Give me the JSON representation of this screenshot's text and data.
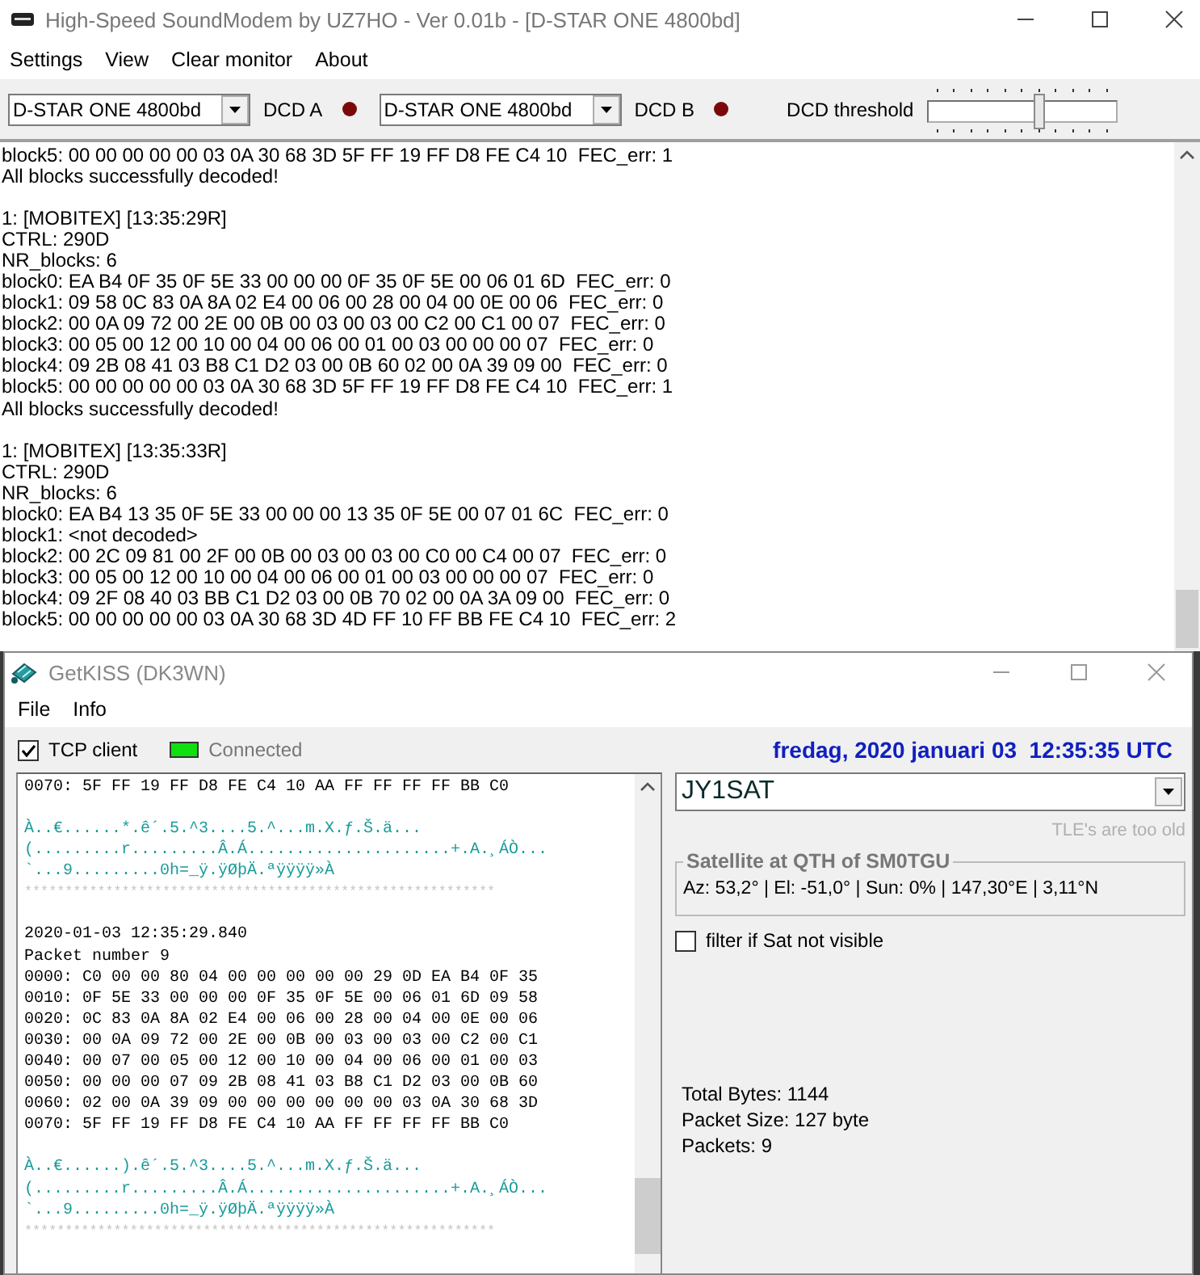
{
  "modem_window": {
    "title": "High-Speed SoundModem by UZ7HO - Ver 0.01b - [D-STAR ONE 4800bd]",
    "menu": [
      "Settings",
      "View",
      "Clear monitor",
      "About"
    ],
    "toolbar": {
      "mode_a": "D-STAR ONE 4800bd",
      "dcd_a_label": "DCD A",
      "dcd_a_active": false,
      "mode_b": "D-STAR ONE 4800bd",
      "dcd_b_label": "DCD B",
      "dcd_b_active": false,
      "threshold_label": "DCD threshold",
      "threshold": {
        "level": 0.59
      }
    },
    "monitor": [
      {
        "lines": [
          "block5: 00 00 00 00 00 03 0A 30 68 3D 5F FF 19 FF D8 FE C4 10  FEC_err: 1",
          "All blocks successfully decoded!"
        ]
      },
      {
        "lines": [
          "1: [MOBITEX] [13:35:29R]",
          "CTRL: 290D",
          "NR_blocks: 6",
          "block0: EA B4 0F 35 0F 5E 33 00 00 00 0F 35 0F 5E 00 06 01 6D  FEC_err: 0",
          "block1: 09 58 0C 83 0A 8A 02 E4 00 06 00 28 00 04 00 0E 00 06  FEC_err: 0",
          "block2: 00 0A 09 72 00 2E 00 0B 00 03 00 03 00 C2 00 C1 00 07  FEC_err: 0",
          "block3: 00 05 00 12 00 10 00 04 00 06 00 01 00 03 00 00 00 07  FEC_err: 0",
          "block4: 09 2B 08 41 03 B8 C1 D2 03 00 0B 60 02 00 0A 39 09 00  FEC_err: 0",
          "block5: 00 00 00 00 00 03 0A 30 68 3D 5F FF 19 FF D8 FE C4 10  FEC_err: 1",
          "All blocks successfully decoded!"
        ]
      },
      {
        "lines": [
          "1: [MOBITEX] [13:35:33R]",
          "CTRL: 290D",
          "NR_blocks: 6",
          "block0: EA B4 13 35 0F 5E 33 00 00 00 13 35 0F 5E 00 07 01 6C  FEC_err: 0",
          "block1: <not decoded>",
          "block2: 00 2C 09 81 00 2F 00 0B 00 03 00 03 00 C0 00 C4 00 07  FEC_err: 0",
          "block3: 00 05 00 12 00 10 00 04 00 06 00 01 00 03 00 00 00 07  FEC_err: 0",
          "block4: 09 2F 08 40 03 BB C1 D2 03 00 0B 70 02 00 0A 3A 09 00  FEC_err: 0",
          "block5: 00 00 00 00 00 03 0A 30 68 3D 4D FF 10 FF BB FE C4 10  FEC_err: 2"
        ]
      }
    ]
  },
  "kiss_window": {
    "title": "GetKISS (DK3WN)",
    "menu": [
      "File",
      "Info"
    ],
    "tcp_client": {
      "label": "TCP client",
      "checked": true
    },
    "connection": {
      "label": "Connected",
      "connected": true
    },
    "datetime": "fredag, 2020 januari 03  12:35:35 UTC",
    "log": [
      {
        "lines": [
          {
            "kind": "hex",
            "text": "0070: 5F FF 19 FF D8 FE C4 10 AA FF FF FF FF BB C0"
          }
        ]
      },
      {
        "lines": [
          {
            "kind": "ascii",
            "text": "À..€......*.ê´.5.^3....5.^...m.X.ƒ.Š.ä..."
          },
          {
            "kind": "ascii",
            "text": "(.........r.........Â.Á.....................+.A.¸ÁÒ..."
          },
          {
            "kind": "ascii",
            "text": "`...9.........0h=_ÿ.ÿØþÄ.ªÿÿÿÿ»À"
          },
          {
            "kind": "separator",
            "text": "**********************************************************"
          }
        ]
      },
      {
        "lines": [
          {
            "kind": "hex",
            "text": "2020-01-03 12:35:29.840"
          },
          {
            "kind": "hex",
            "text": "Packet number 9"
          },
          {
            "kind": "hex",
            "text": "0000: C0 00 00 80 04 00 00 00 00 00 29 0D EA B4 0F 35"
          },
          {
            "kind": "hex",
            "text": "0010: 0F 5E 33 00 00 00 0F 35 0F 5E 00 06 01 6D 09 58"
          },
          {
            "kind": "hex",
            "text": "0020: 0C 83 0A 8A 02 E4 00 06 00 28 00 04 00 0E 00 06"
          },
          {
            "kind": "hex",
            "text": "0030: 00 0A 09 72 00 2E 00 0B 00 03 00 03 00 C2 00 C1"
          },
          {
            "kind": "hex",
            "text": "0040: 00 07 00 05 00 12 00 10 00 04 00 06 00 01 00 03"
          },
          {
            "kind": "hex",
            "text": "0050: 00 00 00 07 09 2B 08 41 03 B8 C1 D2 03 00 0B 60"
          },
          {
            "kind": "hex",
            "text": "0060: 02 00 0A 39 09 00 00 00 00 00 00 03 0A 30 68 3D"
          },
          {
            "kind": "hex",
            "text": "0070: 5F FF 19 FF D8 FE C4 10 AA FF FF FF FF BB C0"
          }
        ]
      },
      {
        "lines": [
          {
            "kind": "ascii",
            "text": "À..€......).ê´.5.^3....5.^...m.X.ƒ.Š.ä..."
          },
          {
            "kind": "ascii",
            "text": "(.........r.........Â.Á.....................+.A.¸ÁÒ..."
          },
          {
            "kind": "ascii",
            "text": "`...9.........0h=_ÿ.ÿØþÄ.ªÿÿÿÿ»À"
          },
          {
            "kind": "separator",
            "text": "**********************************************************"
          }
        ]
      }
    ],
    "satellite": "JY1SAT",
    "tle_note": "TLE's are too old",
    "position": {
      "legend": "Satellite at QTH of SM0TGU",
      "text": "Az: 53,2° | El: -51,0° | Sun: 0% | 147,30°E | 3,11°N"
    },
    "filter": {
      "label": "filter if Sat not visible",
      "checked": false
    },
    "stats": [
      "Total Bytes: 1144",
      "Packet Size: 127 byte",
      "Packets: 9"
    ]
  }
}
